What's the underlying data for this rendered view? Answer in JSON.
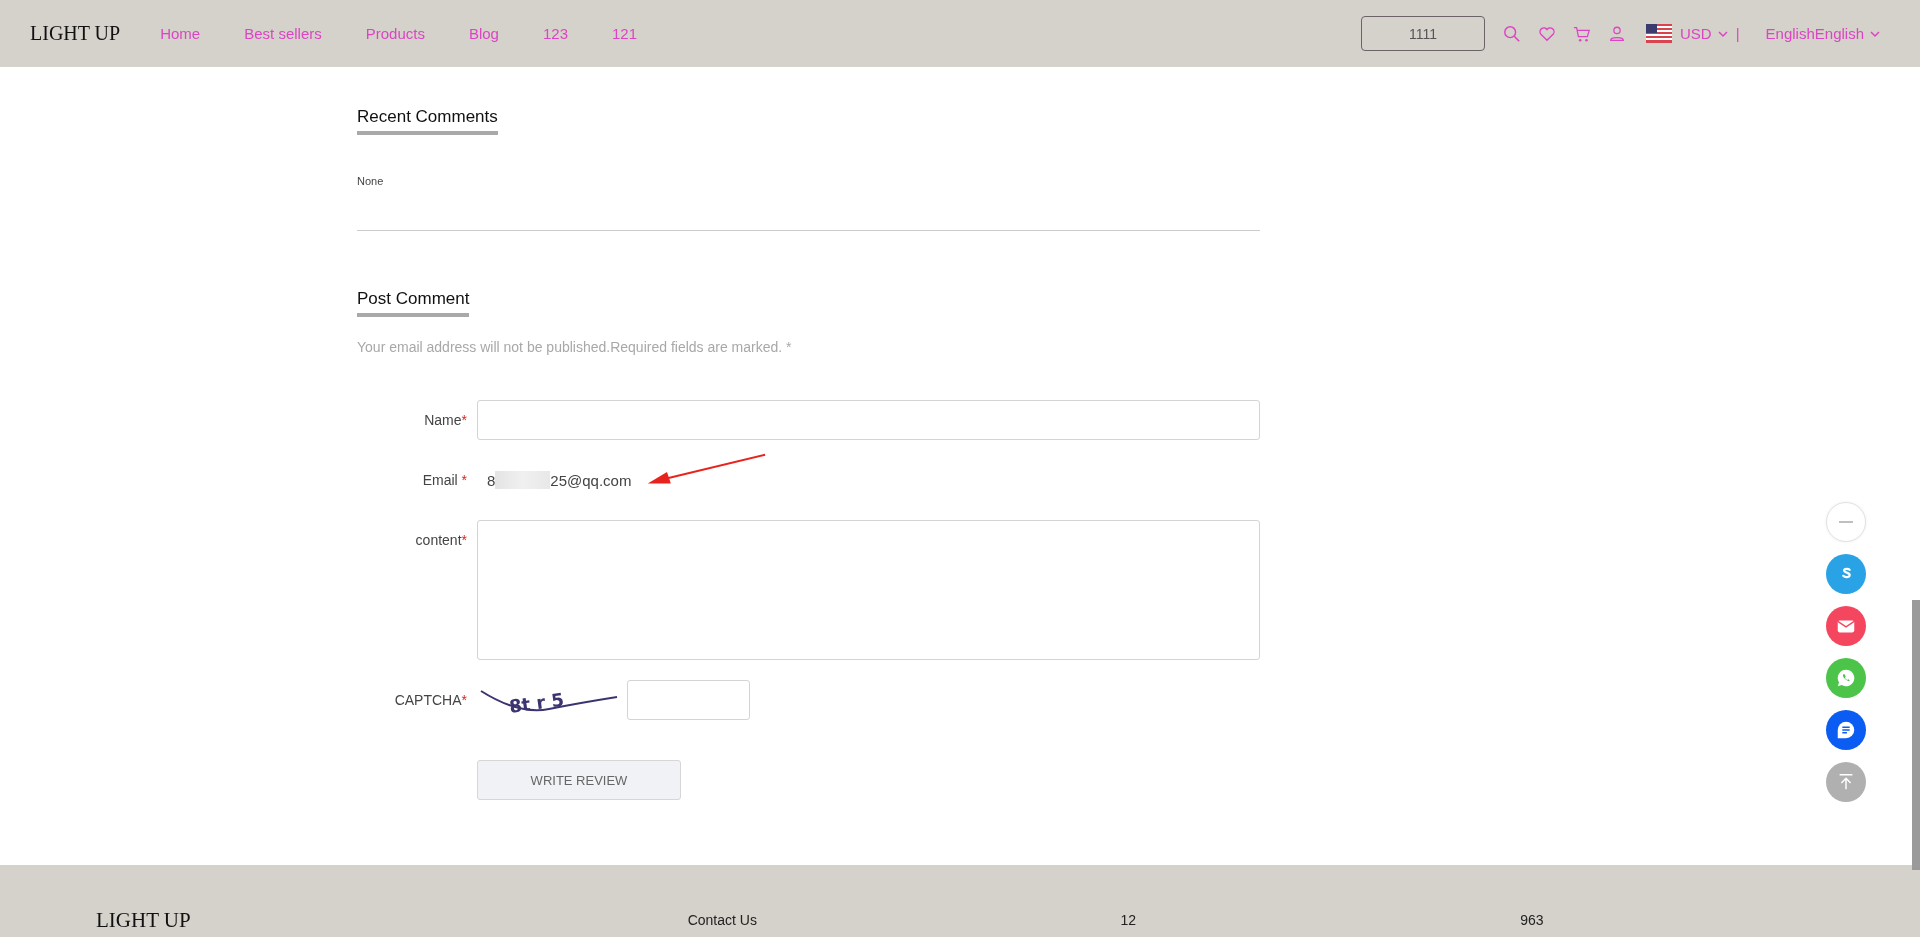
{
  "header": {
    "logo": "LIGHT UP",
    "nav": [
      {
        "label": "Home"
      },
      {
        "label": "Best sellers"
      },
      {
        "label": "Products"
      },
      {
        "label": "Blog"
      },
      {
        "label": "123"
      },
      {
        "label": "121"
      }
    ],
    "search": {
      "value": "1111"
    },
    "currency": "USD",
    "separator": "|",
    "language": "EnglishEnglish"
  },
  "recent_comments": {
    "title": "Recent Comments",
    "text": "None"
  },
  "post_comment": {
    "title": "Post Comment",
    "note": "Your email address will not be published.Required fields are marked. *",
    "fields": [
      {
        "kind": "input",
        "label": "Name",
        "required_mark": "*"
      },
      {
        "kind": "static",
        "label": "Email",
        "required_mark": "*",
        "value_start": "8",
        "value_end": "25@qq.com"
      },
      {
        "kind": "textarea",
        "label": "content",
        "required_mark": "*"
      },
      {
        "kind": "captcha",
        "label": "CAPTCHA",
        "required_mark": "*",
        "captcha_text": "8t r 5"
      }
    ],
    "submit": "WRITE REVIEW"
  },
  "floating_buttons": [
    {
      "kind": "minimize",
      "color": "#ffffff"
    },
    {
      "kind": "skype",
      "color": "#2aa3e6"
    },
    {
      "kind": "email",
      "color": "#f4475f"
    },
    {
      "kind": "whatsapp",
      "color": "#4cc44a"
    },
    {
      "kind": "chat",
      "color": "#0a5cf2"
    },
    {
      "kind": "top",
      "color": "#b0b0b0"
    }
  ],
  "footer": {
    "logo": "LIGHT UP",
    "columns": [
      "Contact Us",
      "12",
      "963"
    ]
  }
}
